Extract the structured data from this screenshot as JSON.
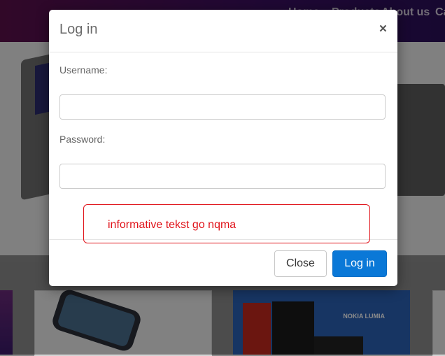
{
  "background": {
    "nav": [
      "Home",
      "Products",
      "About us",
      "Ca"
    ],
    "product_banner_text": "NOKIA LUMIA"
  },
  "modal": {
    "title": "Log in",
    "close_symbol": "×",
    "username_label": "Username:",
    "username_value": "",
    "password_label": "Password:",
    "password_value": "",
    "close_button_label": "Close",
    "login_button_label": "Log in"
  },
  "annotation": {
    "text": "informative tekst go nqma",
    "color": "#e0141b"
  },
  "colors": {
    "primary_button": "#0a78d7",
    "header_gradient_start": "#5a0f4a",
    "header_gradient_end": "#2a0f58"
  }
}
